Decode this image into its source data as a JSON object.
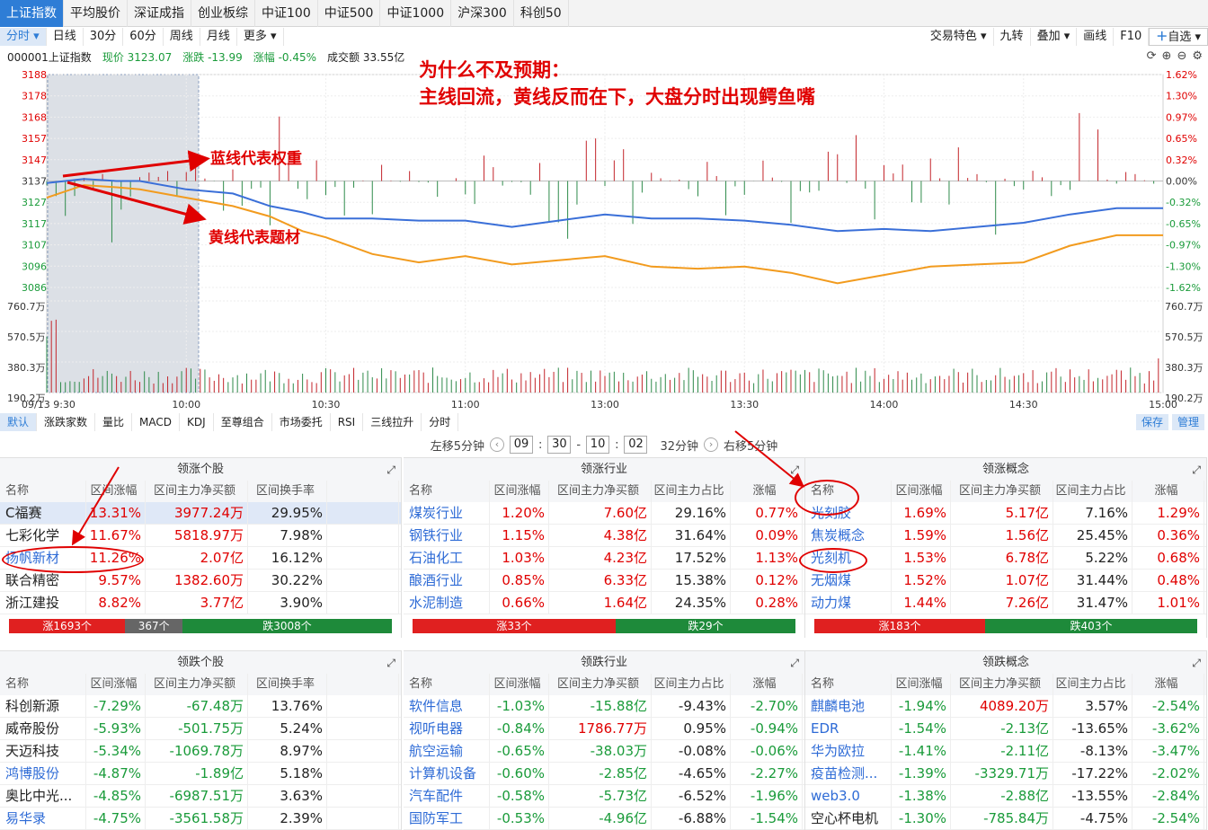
{
  "tabs": [
    "上证指数",
    "平均股价",
    "深证成指",
    "创业板综",
    "中证100",
    "中证500",
    "中证1000",
    "沪深300",
    "科创50"
  ],
  "toolbar": {
    "left": [
      "分时",
      "日线",
      "30分",
      "60分",
      "周线",
      "月线",
      "更多"
    ],
    "right": [
      "交易特色",
      "九转",
      "叠加",
      "画线",
      "F10",
      "自选"
    ]
  },
  "info": {
    "code_name": "000001上证指数",
    "price_label": "现价 3123.07",
    "change_label": "涨跌 -13.99",
    "pct_label": "涨幅 -0.45%",
    "volume_label": "成交额 33.55亿"
  },
  "chart": {
    "left_ticks": [
      "3188",
      "3178",
      "3168",
      "3157",
      "3147",
      "3137",
      "3127",
      "3117",
      "3107",
      "3096",
      "3086"
    ],
    "right_ticks": [
      "1.62%",
      "1.30%",
      "0.97%",
      "0.65%",
      "0.32%",
      "0.00%",
      "-0.32%",
      "-0.65%",
      "-0.97%",
      "-1.30%",
      "-1.62%"
    ],
    "vol_ticks": [
      "760.7万",
      "570.5万",
      "380.3万",
      "190.2万"
    ],
    "time_labels": [
      "09/13 9:30",
      "10:00",
      "10:30",
      "11:00",
      "13:00",
      "13:30",
      "14:00",
      "14:30",
      "15:00"
    ]
  },
  "chart_data": {
    "type": "line",
    "y_range": [
      3086,
      3188
    ],
    "base": 3137,
    "pct_range": [
      -1.62,
      1.62
    ],
    "series": [
      {
        "color": "#3a6fd8",
        "x": [
          0,
          8,
          15,
          20,
          30,
          40,
          48,
          55,
          60,
          70,
          80,
          90,
          100,
          110,
          120,
          130,
          140,
          150,
          160,
          170,
          180,
          190,
          200,
          210,
          220,
          230,
          240
        ],
        "values": [
          3136,
          3138,
          3137,
          3137,
          3133,
          3131,
          3125,
          3122,
          3119,
          3119,
          3118,
          3118,
          3115,
          3118,
          3121,
          3119,
          3119,
          3118,
          3116,
          3113,
          3114,
          3113,
          3115,
          3117,
          3121,
          3124,
          3124
        ]
      },
      {
        "color": "#f29b1e",
        "x": [
          0,
          8,
          15,
          20,
          30,
          40,
          48,
          55,
          60,
          70,
          80,
          90,
          100,
          110,
          120,
          130,
          140,
          150,
          160,
          170,
          180,
          190,
          200,
          210,
          220,
          230,
          240
        ],
        "values": [
          3129,
          3135,
          3134,
          3133,
          3129,
          3125,
          3120,
          3113,
          3110,
          3102,
          3098,
          3101,
          3097,
          3099,
          3101,
          3096,
          3095,
          3096,
          3093,
          3088,
          3092,
          3096,
          3097,
          3098,
          3106,
          3111,
          3111
        ]
      }
    ]
  },
  "annotations": {
    "title1": "为什么不及预期：",
    "title2": "主线回流，黄线反而在下，大盘分时出现鳄鱼嘴",
    "blue_note": "蓝线代表权重",
    "yellow_note": "黄线代表题材"
  },
  "indicators": [
    "默认",
    "涨跌家数",
    "量比",
    "MACD",
    "KDJ",
    "至尊组合",
    "市场委托",
    "RSI",
    "三线拉升",
    "分时"
  ],
  "indicator_right": [
    "保存",
    "管理"
  ],
  "range": {
    "left": "左移5分钟",
    "h1": "09",
    "m1": "30",
    "h2": "10",
    "m2": "02",
    "dur": "32分钟",
    "right": "右移5分钟"
  },
  "panels": [
    {
      "title": "领涨个股",
      "headers": [
        "名称",
        "区间涨幅",
        "区间主力净买额",
        "区间换手率",
        ""
      ],
      "rows": [
        [
          "C福赛",
          "13.31%",
          "3977.24万",
          "29.95%",
          ""
        ],
        [
          "七彩化学",
          "11.67%",
          "5818.97万",
          "7.98%",
          ""
        ],
        [
          "扬帆新材",
          "11.26%",
          "2.07亿",
          "16.12%",
          ""
        ],
        [
          "联合精密",
          "9.57%",
          "1382.60万",
          "30.22%",
          ""
        ],
        [
          "浙江建投",
          "8.82%",
          "3.77亿",
          "3.90%",
          ""
        ]
      ],
      "colors": [
        "r",
        "r",
        "r",
        "r",
        "r"
      ],
      "moneycolors": [
        "r",
        "r",
        "r",
        "r",
        "r"
      ],
      "links": [
        false,
        false,
        true,
        false,
        false
      ],
      "bar": {
        "a": "涨1693个",
        "b": "367个",
        "c": "跌3008个",
        "aw": 130,
        "bw": 64,
        "cw": 234
      }
    },
    {
      "title": "领涨行业",
      "headers": [
        "名称",
        "区间涨幅",
        "区间主力净买额",
        "区间主力占比",
        "涨幅"
      ],
      "rows": [
        [
          "煤炭行业",
          "1.20%",
          "7.60亿",
          "29.16%",
          "0.77%"
        ],
        [
          "钢铁行业",
          "1.15%",
          "4.38亿",
          "31.64%",
          "0.09%"
        ],
        [
          "石油化工",
          "1.03%",
          "4.23亿",
          "17.52%",
          "1.13%"
        ],
        [
          "酿酒行业",
          "0.85%",
          "6.33亿",
          "15.38%",
          "0.12%"
        ],
        [
          "水泥制造",
          "0.66%",
          "1.64亿",
          "24.35%",
          "0.28%"
        ]
      ],
      "colors": [
        "r",
        "r",
        "r",
        "r",
        "r"
      ],
      "moneycolors": [
        "r",
        "r",
        "r",
        "r",
        "r"
      ],
      "links": [
        true,
        true,
        true,
        true,
        true
      ],
      "bar": {
        "a": "涨33个",
        "b": "",
        "c": "跌29个",
        "aw": 226,
        "bw": 0,
        "cw": 200
      }
    },
    {
      "title": "领涨概念",
      "headers": [
        "名称",
        "区间涨幅",
        "区间主力净买额",
        "区间主力占比",
        "涨幅"
      ],
      "rows": [
        [
          "光刻胶",
          "1.69%",
          "5.17亿",
          "7.16%",
          "1.29%"
        ],
        [
          "焦炭概念",
          "1.59%",
          "1.56亿",
          "25.45%",
          "0.36%"
        ],
        [
          "光刻机",
          "1.53%",
          "6.78亿",
          "5.22%",
          "0.68%"
        ],
        [
          "无烟煤",
          "1.52%",
          "1.07亿",
          "31.44%",
          "0.48%"
        ],
        [
          "动力煤",
          "1.44%",
          "7.26亿",
          "31.47%",
          "1.01%"
        ]
      ],
      "colors": [
        "r",
        "r",
        "r",
        "r",
        "r"
      ],
      "moneycolors": [
        "r",
        "r",
        "r",
        "r",
        "r"
      ],
      "links": [
        true,
        true,
        true,
        true,
        true
      ],
      "bar": {
        "a": "涨183个",
        "b": "",
        "c": "跌403个",
        "aw": 190,
        "bw": 0,
        "cw": 236
      }
    },
    {
      "title": "领跌个股",
      "headers": [
        "名称",
        "区间涨幅",
        "区间主力净买额",
        "区间换手率",
        ""
      ],
      "rows": [
        [
          "科创新源",
          "-7.29%",
          "-67.48万",
          "13.76%",
          ""
        ],
        [
          "威帝股份",
          "-5.93%",
          "-501.75万",
          "5.24%",
          ""
        ],
        [
          "天迈科技",
          "-5.34%",
          "-1069.78万",
          "8.97%",
          ""
        ],
        [
          "鸿博股份",
          "-4.87%",
          "-1.89亿",
          "5.18%",
          ""
        ],
        [
          "奥比中光...",
          "-4.85%",
          "-6987.51万",
          "3.63%",
          ""
        ],
        [
          "易华录",
          "-4.75%",
          "-3561.58万",
          "2.39%",
          ""
        ]
      ],
      "colors": [
        "g",
        "g",
        "g",
        "g",
        "g",
        "g"
      ],
      "moneycolors": [
        "g",
        "g",
        "g",
        "g",
        "g",
        "g"
      ],
      "links": [
        false,
        false,
        false,
        true,
        false,
        true
      ]
    },
    {
      "title": "领跌行业",
      "headers": [
        "名称",
        "区间涨幅",
        "区间主力净买额",
        "区间主力占比",
        "涨幅"
      ],
      "rows": [
        [
          "软件信息",
          "-1.03%",
          "-15.88亿",
          "-9.43%",
          "-2.70%"
        ],
        [
          "视听电器",
          "-0.84%",
          "1786.77万",
          "0.95%",
          "-0.94%"
        ],
        [
          "航空运输",
          "-0.65%",
          "-38.03万",
          "-0.08%",
          "-0.06%"
        ],
        [
          "计算机设备",
          "-0.60%",
          "-2.85亿",
          "-4.65%",
          "-2.27%"
        ],
        [
          "汽车配件",
          "-0.58%",
          "-5.73亿",
          "-6.52%",
          "-1.96%"
        ],
        [
          "国防军工",
          "-0.53%",
          "-4.96亿",
          "-6.88%",
          "-1.54%"
        ]
      ],
      "colors": [
        "g",
        "g",
        "g",
        "g",
        "g",
        "g"
      ],
      "moneycolors": [
        "g",
        "r",
        "g",
        "g",
        "g",
        "g"
      ],
      "links": [
        true,
        true,
        true,
        true,
        true,
        true
      ]
    },
    {
      "title": "领跌概念",
      "headers": [
        "名称",
        "区间涨幅",
        "区间主力净买额",
        "区间主力占比",
        "涨幅"
      ],
      "rows": [
        [
          "麒麟电池",
          "-1.94%",
          "4089.20万",
          "3.57%",
          "-2.54%"
        ],
        [
          "EDR",
          "-1.54%",
          "-2.13亿",
          "-13.65%",
          "-3.62%"
        ],
        [
          "华为欧拉",
          "-1.41%",
          "-2.11亿",
          "-8.13%",
          "-3.47%"
        ],
        [
          "疫苗检测...",
          "-1.39%",
          "-3329.71万",
          "-17.22%",
          "-2.02%"
        ],
        [
          "web3.0",
          "-1.38%",
          "-2.88亿",
          "-13.55%",
          "-2.84%"
        ],
        [
          "空心杯电机",
          "-1.30%",
          "-785.84万",
          "-4.75%",
          "-2.54%"
        ]
      ],
      "colors": [
        "g",
        "g",
        "g",
        "g",
        "g",
        "g"
      ],
      "moneycolors": [
        "r",
        "g",
        "g",
        "g",
        "g",
        "g"
      ],
      "links": [
        true,
        true,
        true,
        true,
        true,
        false
      ]
    }
  ]
}
